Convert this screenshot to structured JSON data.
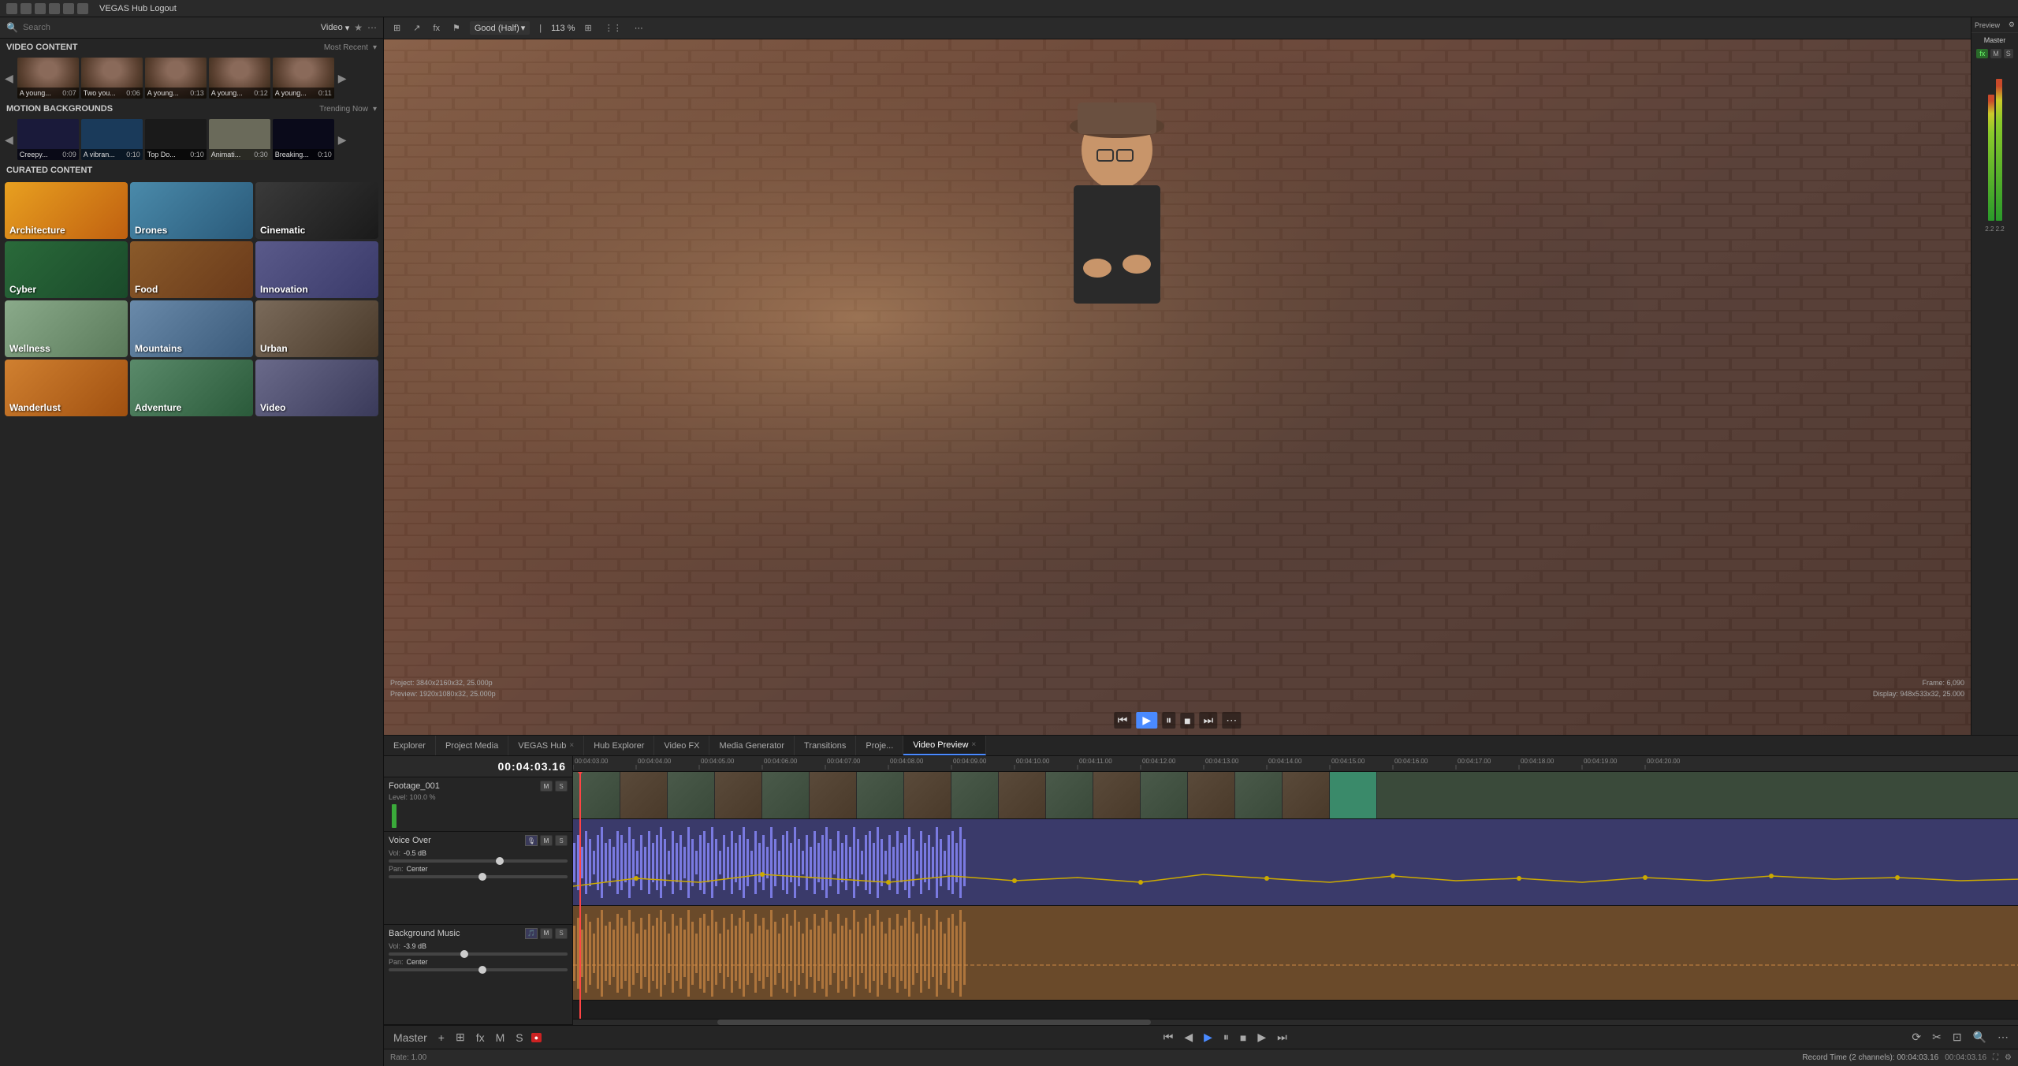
{
  "app": {
    "title": "VEGAS Hub Logout"
  },
  "search": {
    "placeholder": "Search",
    "dropdown_label": "Video",
    "dropdown_arrow": "▾"
  },
  "video_content": {
    "title": "VIDEO CONTENT",
    "sort": "Most Recent",
    "sort_arrow": "▾",
    "thumbnails": [
      {
        "label": "A young...",
        "duration": "0:07"
      },
      {
        "label": "Two you...",
        "duration": "0:06"
      },
      {
        "label": "A young...",
        "duration": "0:13"
      },
      {
        "label": "A young...",
        "duration": "0:12"
      },
      {
        "label": "A young...",
        "duration": "0:11"
      }
    ]
  },
  "motion_backgrounds": {
    "title": "MOTION BACKGROUNDS",
    "sort": "Trending Now",
    "sort_arrow": "▾",
    "thumbnails": [
      {
        "label": "Creepy...",
        "duration": "0:09"
      },
      {
        "label": "A vibran...",
        "duration": "0:10"
      },
      {
        "label": "Top Do...",
        "duration": "0:10"
      },
      {
        "label": "Animati...",
        "duration": "0:30"
      },
      {
        "label": "Breaking...",
        "duration": "0:10"
      }
    ]
  },
  "curated_content": {
    "title": "CURATED CONTENT",
    "items": [
      {
        "label": "Architecture",
        "class": "c-architecture"
      },
      {
        "label": "Drones",
        "class": "c-drones"
      },
      {
        "label": "Cinematic",
        "class": "c-cinematic"
      },
      {
        "label": "Cyber",
        "class": "c-cyber"
      },
      {
        "label": "Food",
        "class": "c-food"
      },
      {
        "label": "Innovation",
        "class": "c-innovation"
      },
      {
        "label": "Wellness",
        "class": "c-wellness"
      },
      {
        "label": "Mountains",
        "class": "c-mountains"
      },
      {
        "label": "Urban",
        "class": "c-urban"
      },
      {
        "label": "Wanderlust",
        "class": "c-wanderlust"
      },
      {
        "label": "Adventure",
        "class": "c-adventure"
      },
      {
        "label": "Video",
        "class": "c-video"
      }
    ]
  },
  "preview": {
    "quality": "Good (Half)",
    "zoom": "113 %",
    "project_info": "Project: 3840x2160x32, 25.000p\nPreview: 1920x1080x32, 25.000p",
    "frame_info": "Frame: 6,090\nDisplay: 948x533x32, 25.000"
  },
  "tabs": [
    {
      "label": "Explorer",
      "active": false
    },
    {
      "label": "Project Media",
      "active": false
    },
    {
      "label": "VEGAS Hub",
      "active": false,
      "has_close": true
    },
    {
      "label": "Hub Explorer",
      "active": false
    },
    {
      "label": "Video FX",
      "active": false
    },
    {
      "label": "Media Generator",
      "active": false
    },
    {
      "label": "Transitions",
      "active": false
    },
    {
      "label": "Proje...",
      "active": false
    },
    {
      "label": "Video Preview",
      "active": false,
      "has_close": true
    }
  ],
  "timeline": {
    "current_time": "00:04:03.16",
    "tracks": [
      {
        "name": "Footage_001",
        "level": "Level: 100.0 %",
        "controls": [
          "M",
          "S"
        ],
        "type": "video"
      },
      {
        "name": "Voice Over",
        "vol": "Vol: -0.5 dB",
        "pan": "Pan: Center",
        "controls": [
          "M",
          "S"
        ],
        "type": "audio_purple"
      },
      {
        "name": "Background Music",
        "vol": "Vol: -3.9 dB",
        "pan": "Pan: Center",
        "controls": [
          "M",
          "S"
        ],
        "type": "audio_orange"
      }
    ],
    "ruler_marks": [
      "00:04:03.00",
      "00:04:04.00",
      "00:04:05.00",
      "00:04:06.00",
      "00:04:07.00",
      "00:04:08.00",
      "00:04:09.00",
      "00:04:10.00",
      "00:04:11.00",
      "00:04:12.00",
      "00:04:13.00",
      "00:04:14.00",
      "00:04:15.00",
      "00:04:16.00",
      "00:04:17.00",
      "00:04:18.00",
      "00:04:19.00",
      "00:04:20.00"
    ]
  },
  "master": {
    "label": "Master",
    "rate": "Rate: 1.00"
  },
  "mixer": {
    "preview_label": "Preview",
    "master_label": "Master",
    "fx_label": "fx",
    "m_label": "M",
    "s_label": "S"
  },
  "record_time": "Record Time (2 channels): 00:04:03.16",
  "icons": {
    "play": "▶",
    "pause": "⏸",
    "stop": "■",
    "rewind": "◀◀",
    "ff": "▶▶",
    "prev": "⏮",
    "next": "⏭",
    "chevron_down": "▾",
    "chevron_left": "◀",
    "chevron_right": "▶",
    "star": "★",
    "close": "×",
    "search": "🔍",
    "settings": "⚙"
  }
}
